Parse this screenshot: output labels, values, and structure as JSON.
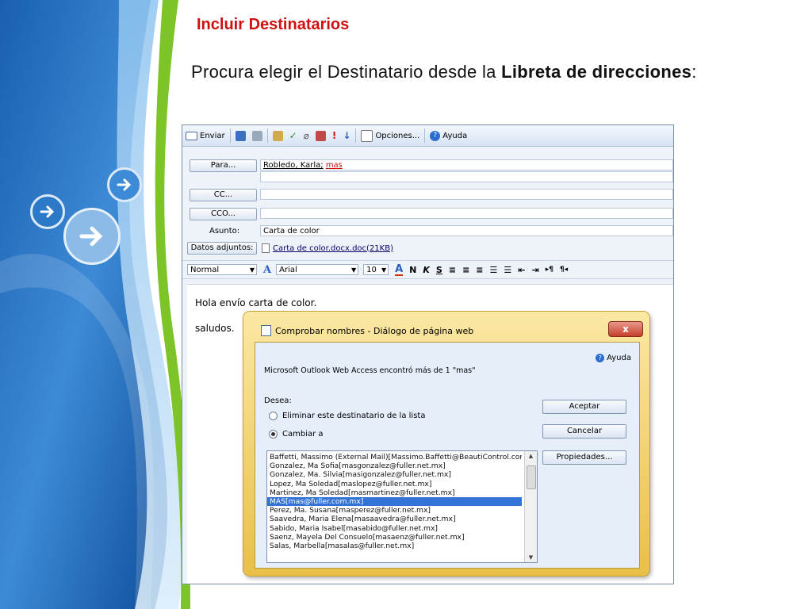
{
  "slide": {
    "title": "Incluir Destinatarios",
    "text_part1": "Procura elegir el Destinatario desde la ",
    "text_bold": "Libreta de direcciones",
    "text_part2": ":"
  },
  "toolbar": {
    "send": "Enviar",
    "options": "Opciones...",
    "help": "Ayuda"
  },
  "header": {
    "to_button": "Para...",
    "to_value_1": "Robledo, Karla;",
    "to_value_2": "mas",
    "cc_button": "CC...",
    "bcc_button": "CCO...",
    "subject_label": "Asunto:",
    "subject_value": "Carta de color",
    "attachments_button": "Datos adjuntos:",
    "attachment_file": "Carta de color.docx.doc(21KB)"
  },
  "format": {
    "style": "Normal",
    "font": "Arial",
    "size": "10"
  },
  "body": {
    "line1": "Hola envío carta de color.",
    "line2": "saludos."
  },
  "dialog": {
    "title": "Comprobar nombres - Diálogo de página web",
    "close": "x",
    "help": "Ayuda",
    "message": "Microsoft Outlook Web Access encontró más de 1 \"mas\"",
    "desea": "Desea:",
    "option_remove": "Eliminar este destinatario de la lista",
    "option_change": "Cambiar a",
    "accept": "Aceptar",
    "cancel": "Cancelar",
    "properties": "Propiedades...",
    "list": [
      "Baffetti, Massimo (External Mail)[Massimo.Baffetti@BeautiControl.com",
      "Gonzalez, Ma Sofia[masgonzalez@fuller.net.mx]",
      "Gonzalez, Ma. Silvia[masigonzalez@fuller.net.mx]",
      "Lopez, Ma Soledad[maslopez@fuller.net.mx]",
      "Martinez, Ma Soledad[masmartinez@fuller.net.mx]",
      "MAS[mas@fuller.com.mx]",
      "Perez, Ma. Susana[masperez@fuller.net.mx]",
      "Saavedra, Maria Elena[masaavedra@fuller.net.mx]",
      "Sabido, Maria Isabel[masabido@fuller.net.mx]",
      "Saenz, Mayela Del Consuelo[masaenz@fuller.net.mx]",
      "Salas, Marbella[masalas@fuller.net.mx]"
    ],
    "selected_index": 5
  },
  "colors": {
    "title_red": "#d01010",
    "band_blue": "#1e6fc0",
    "band_green": "#7cc427",
    "selection": "#3473d6"
  }
}
